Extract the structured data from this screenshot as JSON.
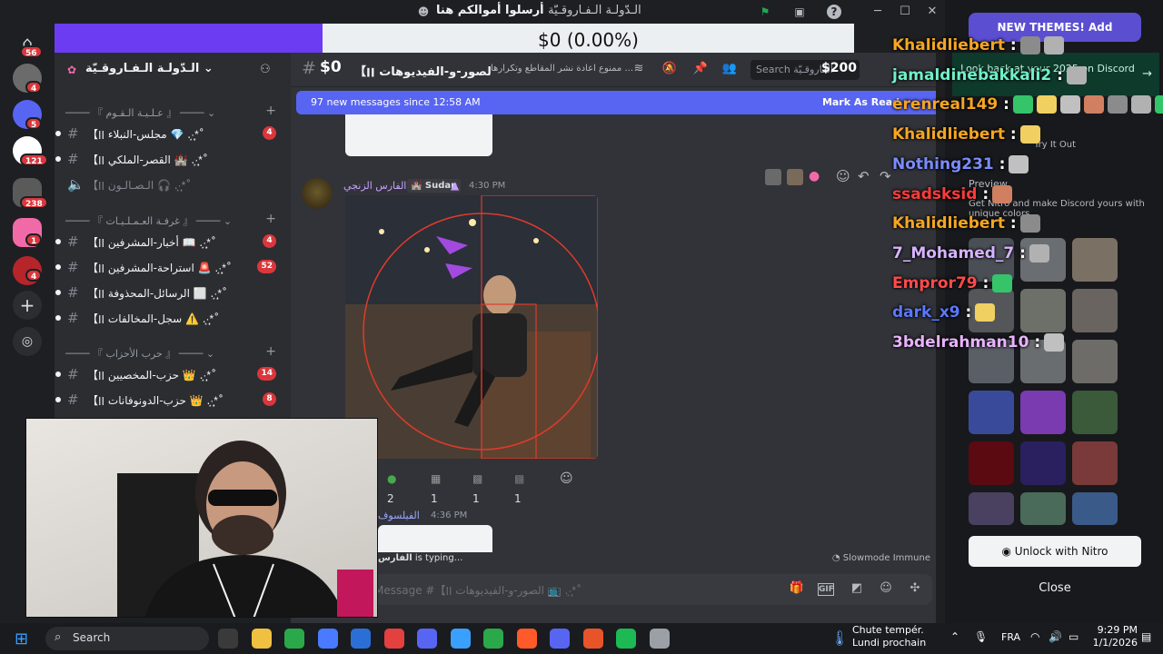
{
  "window": {
    "title": "أرسلوا أموالكم هنا",
    "server_title": "الـدّولـة الـفـاروقـيّة"
  },
  "stream": {
    "donation_progress": "$0 (0.00%)",
    "goal_left": "$0",
    "goal_right": "$200"
  },
  "rail": {
    "badges": [
      "56",
      "4",
      "5",
      "121",
      "238",
      "1",
      "4"
    ]
  },
  "sidebar": {
    "server_name": "الـدّولـة الـفـاروقـيّة",
    "categories": [
      {
        "label": "『 عـلـيـة الـقـوم 』",
        "channels": [
          {
            "name": "【مجلس-النبلاء ׀׀ 💎 .·͙*̩̩͙˚",
            "badge": "4",
            "type": "text"
          },
          {
            "name": "【القصر-الملكي ׀׀ 🏰 .·͙*̩̩͙˚",
            "badge": "",
            "type": "text"
          },
          {
            "name": "【الـصـالـون ׀׀ 🎧 .·͙*̩̩͙˚",
            "badge": "",
            "type": "voice"
          }
        ]
      },
      {
        "label": "『 غرفـة العـمـلـيـات 』",
        "channels": [
          {
            "name": "【أخبار-المشرفين ׀׀ 📖 .·͙*̩̩͙˚",
            "badge": "4",
            "type": "text"
          },
          {
            "name": "【استراحة-المشرفين ׀׀ 🚨 .·͙*̩̩͙˚",
            "badge": "52",
            "type": "text"
          },
          {
            "name": "【الرسائل-المحذوفة ׀׀ ⬜ .·͙*̩̩͙˚",
            "badge": "",
            "type": "text"
          },
          {
            "name": "【سجل-المخالفات ׀׀ ⚠️ .·͙*̩̩͙˚",
            "badge": "",
            "type": "text"
          }
        ]
      },
      {
        "label": "『 حرب الأحزاب 』",
        "channels": [
          {
            "name": "【حزب-المخصيين ׀׀ 👑 .·͙*̩̩͙˚",
            "badge": "14",
            "type": "text"
          },
          {
            "name": "【حزب-الدونوفانات ׀׀ 👑 .·͙*̩̩͙˚",
            "badge": "8",
            "type": "text"
          }
        ]
      }
    ]
  },
  "chat": {
    "channel_name": "【الصور-و-الفيديوهات ׀׀ 📺 .·͙*̩̩͙˚",
    "topic": "ممنوع اعادة نشر المقاطع وتكرارها ...",
    "search_placeholder": "Search الفاروقـيّة",
    "new_messages": "97 new messages since 12:58 AM",
    "mark_as_read": "Mark As Read",
    "message1": {
      "author": "الفارس الزنجي",
      "server_tag": "🏰 Sudan",
      "time": "4:30 PM",
      "reactions": [
        {
          "count": "2"
        },
        {
          "count": "1"
        },
        {
          "count": "1"
        },
        {
          "count": "1"
        }
      ]
    },
    "message2": {
      "author": "الفيلسوف",
      "time": "4:36 PM"
    },
    "typing": "is typing...",
    "typing_user": "الفارس",
    "slowmode": "Slowmode Immune",
    "composer_placeholder": "Message #【الصور-و-الفيديوهات ׀׀ 📺 .·͙*̩̩͙˚"
  },
  "theme_panel": {
    "new_themes": "NEW THEMES! Add",
    "lookback": "Look back at your 2025 on Discord",
    "try_it_out": "Try It Out",
    "preview": "Preview",
    "nitro_desc": "Get Nitro and make Discord yours with unique colors.",
    "unlock": "Unlock with Nitro",
    "close": "Close",
    "swatch_colors": [
      "#4a4f55",
      "#6a6e72",
      "#7a7064",
      "#55565a",
      "#6d7068",
      "#6a6460",
      "#5a5f66",
      "#6a6d70",
      "#6e6c68",
      "#3a4a9a",
      "#7a3ab0",
      "#3a5a3a",
      "#5a0a10",
      "#2a2060",
      "#7a3a3a",
      "#4a4060",
      "#4a6a5a",
      "#3a5a8a"
    ]
  },
  "chat_overlay": {
    "lines": [
      {
        "user": "Khalidliebert",
        "color": "#f5a623",
        "emotes": 2
      },
      {
        "user": "jamaldinebakkali2",
        "color": "#6ff0c8",
        "emotes": 1
      },
      {
        "user": "erenreal149",
        "color": "#f5a623",
        "emotes": 7
      },
      {
        "user": "Khalidliebert",
        "color": "#f5a623",
        "emotes": 1
      },
      {
        "user": "Nothing231",
        "color": "#7a8cff",
        "emotes": 1
      },
      {
        "user": "ssadsksid",
        "color": "#ff3b3b",
        "emotes": 1
      },
      {
        "user": "Khalidliebert",
        "color": "#f5a623",
        "emotes": 1
      },
      {
        "user": "7_Mohamed_7",
        "color": "#d6b3ff",
        "emotes": 1
      },
      {
        "user": "Empror79",
        "color": "#ff4a4a",
        "emotes": 1
      },
      {
        "user": "dark_x9",
        "color": "#5b78ff",
        "emotes": 1
      },
      {
        "user": "3bdelrahman10",
        "color": "#e8b3ff",
        "emotes": 1
      }
    ]
  },
  "taskbar": {
    "search": "Search",
    "weather_line1": "Chute tempér.",
    "weather_line2": "Lundi prochain",
    "lang": "FRA",
    "time": "9:29 PM",
    "date": "1/1/2026",
    "app_colors": [
      "#3a3a3a",
      "#f0c040",
      "#2aa84a",
      "#4a7aff",
      "#2b6fd6",
      "#e34040",
      "#5865f2",
      "#3aa0ff",
      "#2aa84a",
      "#ff5a2a",
      "#5865f2",
      "#e8542a",
      "#1db954",
      "#9aa0a6"
    ]
  }
}
